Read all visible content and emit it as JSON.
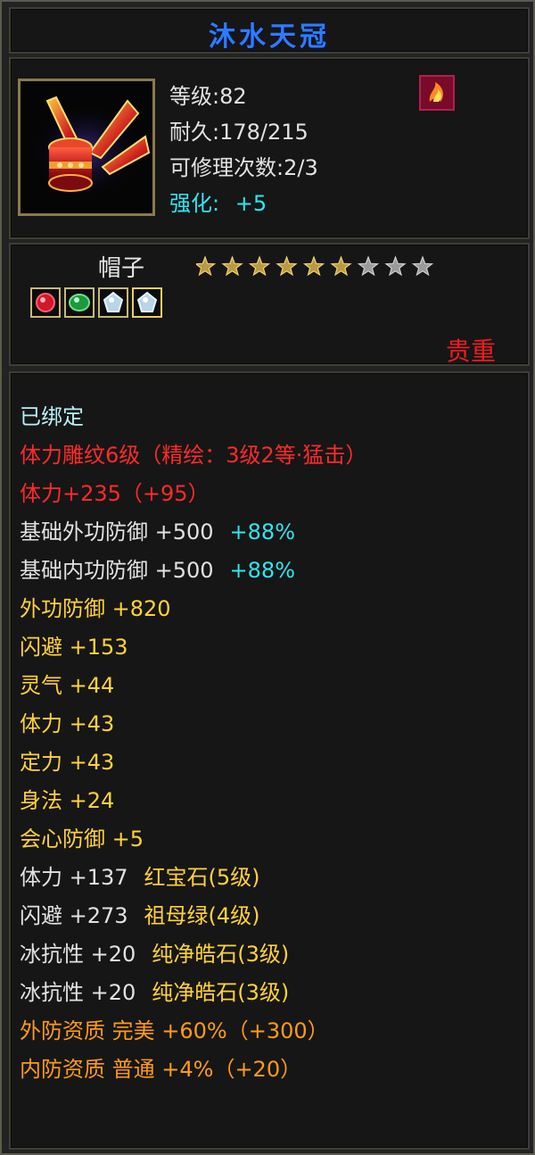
{
  "item": {
    "name": "沐水天冠"
  },
  "info": {
    "level": "等级:82",
    "durability": "耐久:178/215",
    "repair": "可修理次数:2/3",
    "enhance_label": "强化:",
    "enhance_value": "+5"
  },
  "type": {
    "label": "帽子",
    "stars_filled": 6,
    "stars_total": 9,
    "rarity": "贵重"
  },
  "gems": [
    "ruby-gem-icon",
    "emerald-gem-icon",
    "pure-stone-gem-icon",
    "pure-stone-gem-icon"
  ],
  "colors": {
    "title": "#2f7bff",
    "cyan": "#b8f0f5",
    "red": "#ff2a2a",
    "white": "#e2e2e2",
    "yellow": "#ffd23a",
    "orange": "#ff9a1a",
    "bright_cyan": "#30e6f0"
  },
  "properties": [
    {
      "text": "已绑定",
      "color": "cyan"
    },
    {
      "text": "体力雕纹6级（精绘：3级2等·猛击）",
      "color": "red"
    },
    {
      "text": "体力+235（+95）",
      "color": "red"
    },
    {
      "text": "基础外功防御 +500",
      "extra": "+88%",
      "color": "white",
      "extra_color": "bright_cyan"
    },
    {
      "text": "基础内功防御 +500",
      "extra": "+88%",
      "color": "white",
      "extra_color": "bright_cyan"
    },
    {
      "text": "外功防御 +820",
      "color": "yellow"
    },
    {
      "text": "闪避 +153",
      "color": "yellow"
    },
    {
      "text": "灵气 +44",
      "color": "yellow"
    },
    {
      "text": "体力 +43",
      "color": "yellow"
    },
    {
      "text": "定力 +43",
      "color": "yellow"
    },
    {
      "text": "身法 +24",
      "color": "yellow"
    },
    {
      "text": "会心防御 +5",
      "color": "yellow"
    },
    {
      "text": "体力 +137",
      "extra": "红宝石(5级)",
      "color": "white",
      "extra_color": "yellow"
    },
    {
      "text": "闪避 +273",
      "extra": "祖母绿(4级)",
      "color": "white",
      "extra_color": "yellow"
    },
    {
      "text": "冰抗性 +20",
      "extra": "纯净皓石(3级)",
      "color": "white",
      "extra_color": "yellow"
    },
    {
      "text": "冰抗性 +20",
      "extra": "纯净皓石(3级)",
      "color": "white",
      "extra_color": "yellow"
    },
    {
      "text": "外防资质  完美 +60%（+300）",
      "color": "orange"
    },
    {
      "text": "内防资质  普通 +4%（+20）",
      "color": "orange"
    }
  ]
}
